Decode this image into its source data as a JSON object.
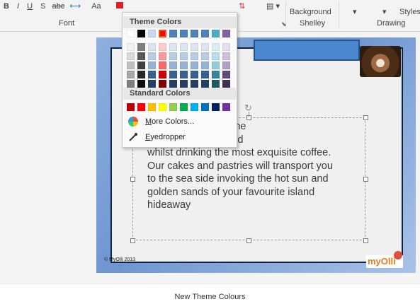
{
  "ribbon": {
    "font_group_label": "Font",
    "drawing_group_label": "Drawing",
    "theme_group_label": "Shelley",
    "background_label": "Background",
    "styles_label": "Styles"
  },
  "color_picker": {
    "theme_header": "Theme Colors",
    "standard_header": "Standard Colors",
    "more_colors_prefix": "M",
    "more_colors_rest": "ore Colors...",
    "eyedropper_prefix": "E",
    "eyedropper_rest": "yedropper",
    "theme_colors": [
      [
        "#ffffff",
        "#f2f2f2",
        "#d9d9d9",
        "#bfbfbf",
        "#a6a6a6",
        "#808080"
      ],
      [
        "#000000",
        "#808080",
        "#595959",
        "#404040",
        "#262626",
        "#0d0d0d"
      ],
      [
        "#c6d9f1",
        "#dbe5f1",
        "#b8cce4",
        "#95b3d7",
        "#366092",
        "#244062"
      ],
      [
        "#ff0000",
        "#ffcccc",
        "#ff9999",
        "#ff6666",
        "#cc0000",
        "#800000"
      ],
      [
        "#4f81bd",
        "#dce6f1",
        "#b8cce4",
        "#95b3d7",
        "#366092",
        "#244062"
      ],
      [
        "#4f81bd",
        "#dce6f1",
        "#b8cce4",
        "#95b3d7",
        "#366092",
        "#244062"
      ],
      [
        "#4f81bd",
        "#dce6f1",
        "#b8cce4",
        "#95b3d7",
        "#366092",
        "#244062"
      ],
      [
        "#4f81bd",
        "#dce6f1",
        "#b8cce4",
        "#95b3d7",
        "#366092",
        "#244062"
      ],
      [
        "#4bacc6",
        "#daeef3",
        "#b7dee8",
        "#93cddd",
        "#31859c",
        "#215868"
      ],
      [
        "#8064a2",
        "#e4dfec",
        "#ccc0da",
        "#b1a0c7",
        "#60497a",
        "#403151"
      ]
    ],
    "standard_colors": [
      "#c00000",
      "#ff0000",
      "#ffc000",
      "#ffff00",
      "#92d050",
      "#00b050",
      "#00b0f0",
      "#0070c0",
      "#002060",
      "#7030a0"
    ]
  },
  "slide": {
    "body_text": "ou will experience the\nere of a desert island\nwhilst drinking the most exquisite coffee.\nOur cakes and pastries will transport you\nto the sea side invoking the hot sun and\ngolden sands of your favourite island\nhideaway",
    "footer": "© MyOlli 2013",
    "logo": "myOlli"
  },
  "caption": "New Theme Colours"
}
